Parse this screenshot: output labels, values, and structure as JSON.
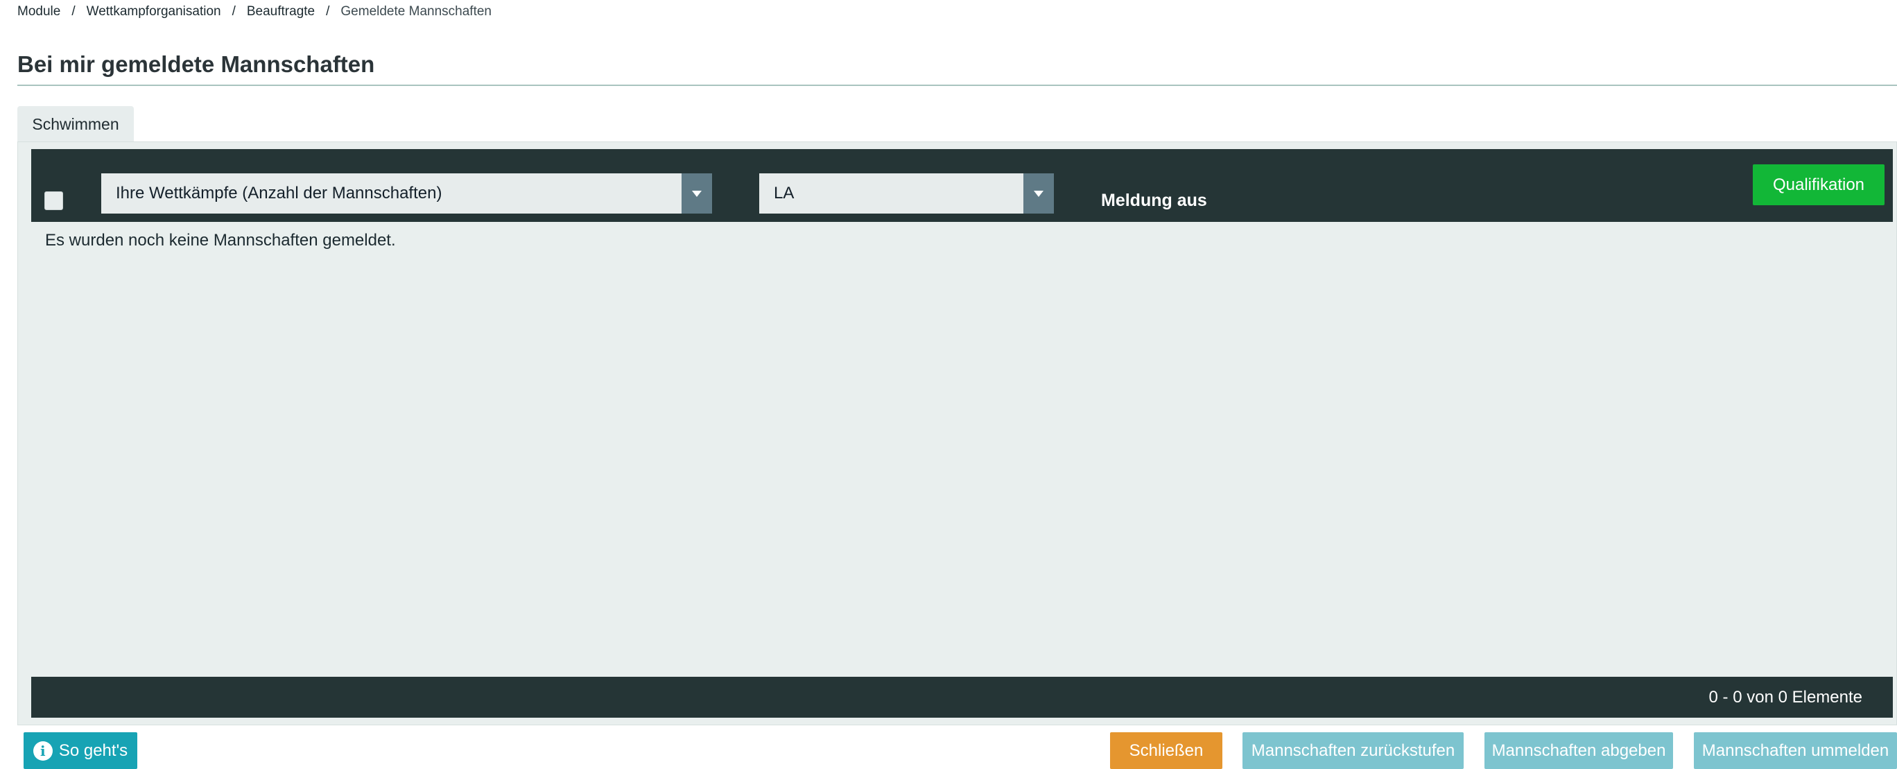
{
  "breadcrumb": {
    "items": [
      "Module",
      "Wettkampforganisation",
      "Beauftragte"
    ],
    "current": "Gemeldete Mannschaften",
    "separator": "/"
  },
  "page": {
    "title": "Bei mir gemeldete Mannschaften"
  },
  "tabs": [
    {
      "label": "Schwimmen",
      "active": true
    }
  ],
  "filter": {
    "competition_select": {
      "value": "Ihre Wettkämpfe (Anzahl der Mannschaften)"
    },
    "region_select": {
      "value": "LA"
    },
    "meldung_label": "Meldung aus",
    "qualification_button": "Qualifikation"
  },
  "table": {
    "empty_message": "Es wurden noch keine Mannschaften gemeldet.",
    "pager_text": "0 - 0 von 0 Elemente"
  },
  "actions": {
    "help": "So geht's",
    "close": "Schließen",
    "downgrade": "Mannschaften zurückstufen",
    "submit": "Mannschaften abgeben",
    "reassign": "Mannschaften ummelden"
  },
  "colors": {
    "header_bar": "#253536",
    "panel_bg": "#e9efee",
    "qual_button": "#12b737",
    "help_button": "#17a3b4",
    "close_button": "#e5962f",
    "soft_button": "#7dc4cf"
  },
  "icons": {
    "dropdown": "chevron-down-icon",
    "help": "info-icon"
  }
}
